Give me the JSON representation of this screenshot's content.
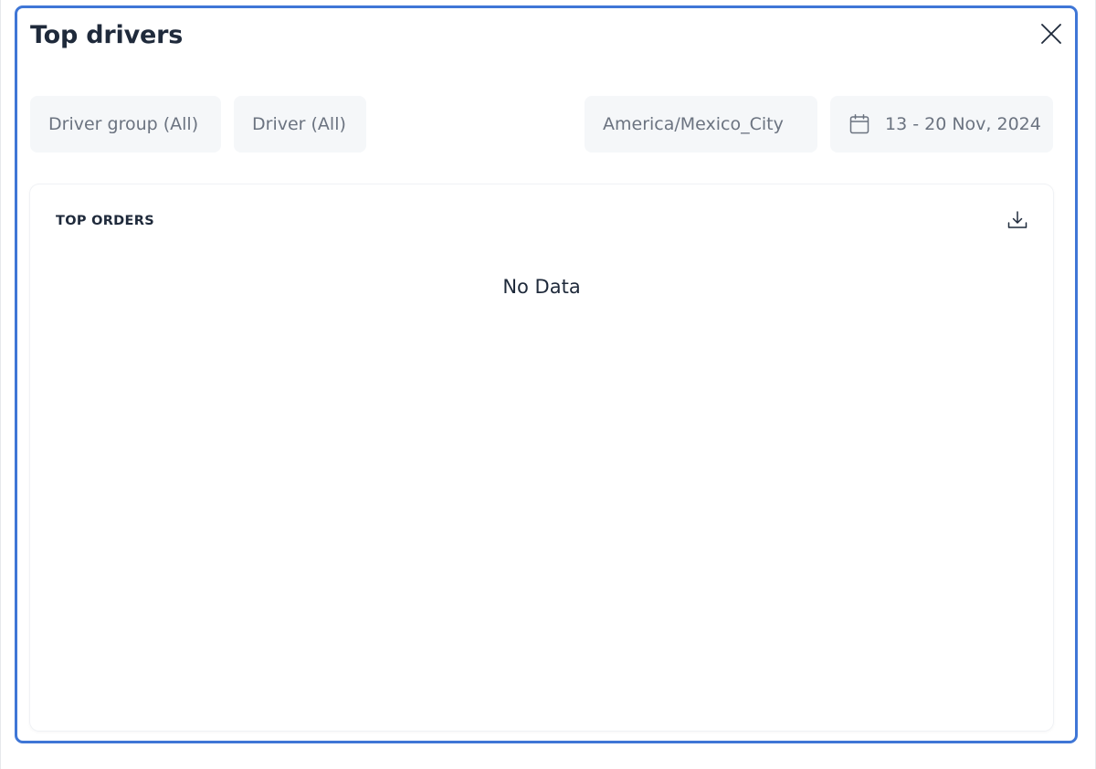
{
  "modal": {
    "title": "Top drivers",
    "close_icon": "close-icon",
    "accent_color": "#3f76d6"
  },
  "filters": {
    "driver_group": "Driver group (All)",
    "driver": "Driver (All)",
    "timezone": "America/Mexico_City",
    "date_range": "13 - 20 Nov, 2024",
    "date_icon": "calendar-icon"
  },
  "card": {
    "title": "TOP ORDERS",
    "download_icon": "download-icon",
    "empty_message": "No Data"
  }
}
